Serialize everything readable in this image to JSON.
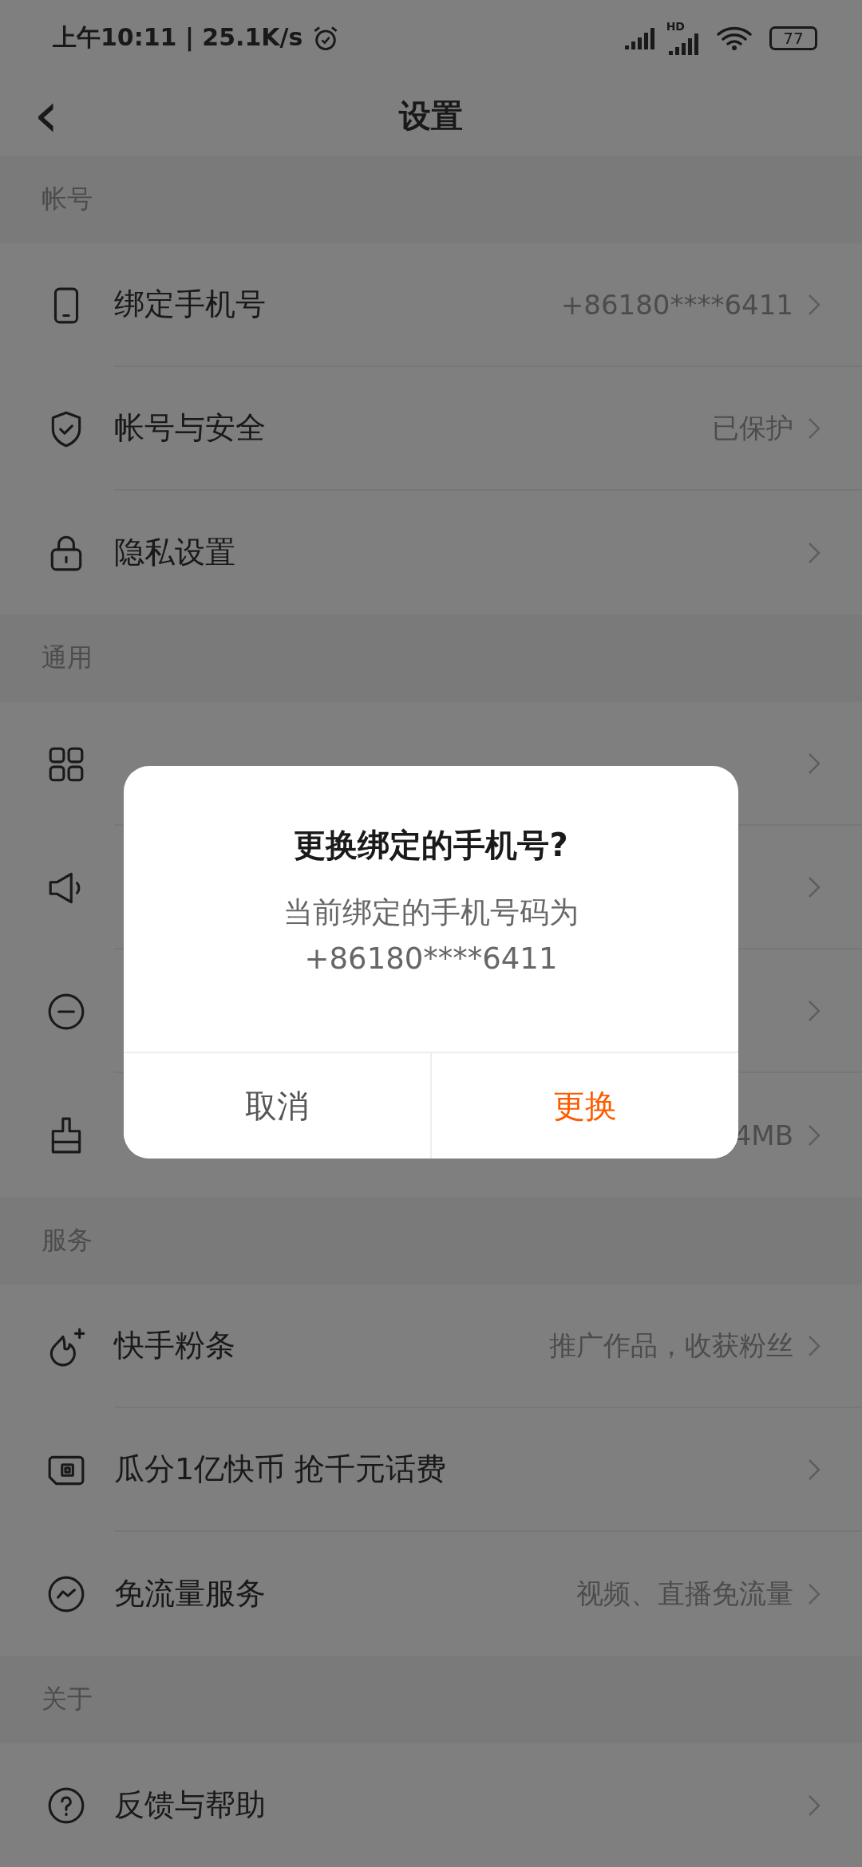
{
  "status_bar": {
    "time": "上午10:11 | 25.1K/s",
    "hd": "HD",
    "battery": "77"
  },
  "header": {
    "back": "‹",
    "title": "设置"
  },
  "sections": [
    {
      "title": "帐号",
      "rows": [
        {
          "label": "绑定手机号",
          "value": "+86180****6411"
        },
        {
          "label": "帐号与安全",
          "value": "已保护"
        },
        {
          "label": "隐私设置"
        }
      ]
    },
    {
      "title": "通用",
      "rows": [
        {},
        {},
        {},
        {
          "value": "4MB"
        }
      ]
    },
    {
      "title": "服务",
      "rows": [
        {
          "label": "快手粉条",
          "value": "推广作品，收获粉丝"
        },
        {
          "label": "瓜分1亿快币 抢千元话费"
        },
        {
          "label": "免流量服务",
          "value": "视频、直播免流量"
        }
      ]
    },
    {
      "title": "关于",
      "rows": [
        {
          "label": "反馈与帮助"
        }
      ]
    }
  ],
  "dialog": {
    "title": "更换绑定的手机号?",
    "message": [
      "当前绑定的手机号码为",
      "+86180****6411"
    ],
    "buttons": [
      {
        "label": "取消",
        "kind": "cancel"
      },
      {
        "label": "更换",
        "kind": "primary"
      }
    ]
  }
}
